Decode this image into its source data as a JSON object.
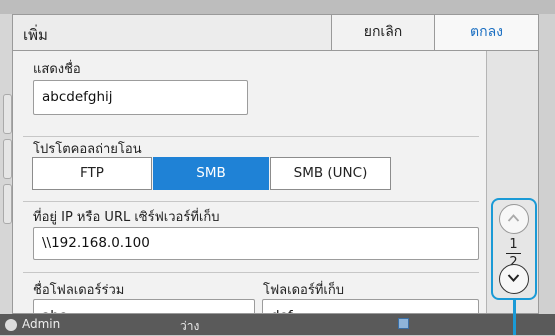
{
  "background": {
    "user": "Admin",
    "middle_text": "ว่าง"
  },
  "dialog": {
    "title": "เพิ่ม",
    "cancel_label": "ยกเลิก",
    "ok_label": "ตกลง",
    "display_name": {
      "label": "แสดงชื่อ",
      "value": "abcdefghij"
    },
    "protocol": {
      "label": "โปรโตคอลถ่ายโอน",
      "options": [
        "FTP",
        "SMB",
        "SMB (UNC)"
      ],
      "selected": "SMB"
    },
    "server_address": {
      "label": "ที่อยู่ IP หรือ URL เซิร์ฟเวอร์ที่เก็บ",
      "value": "\\\\192.168.0.100"
    },
    "shared_folder": {
      "label": "ชื่อโฟลเดอร์ร่วม",
      "value": "abc"
    },
    "storage_folder": {
      "label": "โฟลเดอร์ที่เก็บ",
      "value": "def"
    },
    "pagination": {
      "current": "1",
      "total": "2"
    }
  },
  "colors": {
    "accent": "#1f82d6",
    "callout": "#1a9ad6"
  }
}
